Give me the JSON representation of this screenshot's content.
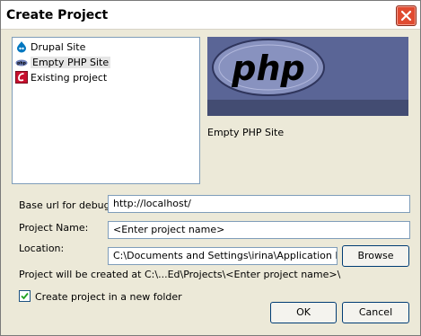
{
  "window": {
    "title": "Create Project"
  },
  "project_types": [
    {
      "label": "Drupal Site",
      "icon": "drupal-icon",
      "selected": false
    },
    {
      "label": "Empty PHP Site",
      "icon": "php-icon",
      "selected": true
    },
    {
      "label": "Existing project",
      "icon": "existing-project-icon",
      "selected": false
    }
  ],
  "preview": {
    "logo_text": "php",
    "caption": "Empty PHP Site"
  },
  "form": {
    "base_url_label": "Base url for debug:",
    "base_url_value": "http://localhost/",
    "project_name_label": "Project Name:",
    "project_name_value": "<Enter project name>",
    "location_label": "Location:",
    "location_value": "C:\\Documents and Settings\\irina\\Application Data\\C",
    "browse_label": "Browse",
    "info_text": "Project will be created at C:\\...Ed\\Projects\\<Enter project name>\\",
    "checkbox_label": "Create project in a new folder",
    "checkbox_checked": true
  },
  "buttons": {
    "ok": "OK",
    "cancel": "Cancel"
  },
  "colors": {
    "php_preview_bg": "#5a6596",
    "php_logo_fill": "#8892bf",
    "title_close": "#e04b31"
  }
}
